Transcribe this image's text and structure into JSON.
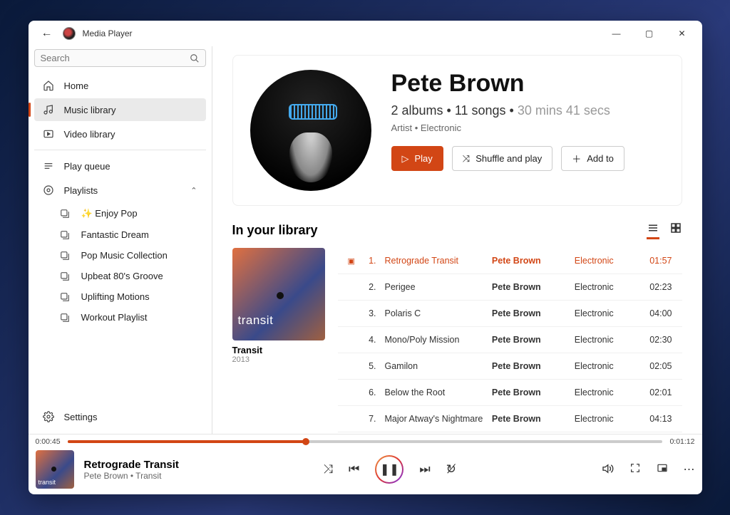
{
  "app_title": "Media Player",
  "search_placeholder": "Search",
  "sidebar": {
    "home": "Home",
    "music": "Music library",
    "video": "Video library",
    "queue": "Play queue",
    "playlists_label": "Playlists",
    "playlists": [
      {
        "label": "✨ Enjoy Pop"
      },
      {
        "label": "Fantastic Dream"
      },
      {
        "label": "Pop Music Collection"
      },
      {
        "label": "Upbeat 80's Groove"
      },
      {
        "label": "Uplifting Motions"
      },
      {
        "label": "Workout Playlist"
      }
    ],
    "settings": "Settings"
  },
  "artist": {
    "name": "Pete Brown",
    "meta_prefix": "2 albums • 11 songs • ",
    "meta_dim": "30 mins 41 secs",
    "role": "Artist • Electronic",
    "play_label": "Play",
    "shuffle_label": "Shuffle and play",
    "addto_label": "Add to"
  },
  "section_title": "In your library",
  "album": {
    "title": "Transit",
    "year": "2013",
    "art_label": "transit"
  },
  "tracks": [
    {
      "n": "1.",
      "name": "Retrograde Transit",
      "artist": "Pete Brown",
      "genre": "Electronic",
      "dur": "01:57",
      "playing": true
    },
    {
      "n": "2.",
      "name": "Perigee",
      "artist": "Pete Brown",
      "genre": "Electronic",
      "dur": "02:23"
    },
    {
      "n": "3.",
      "name": "Polaris C",
      "artist": "Pete Brown",
      "genre": "Electronic",
      "dur": "04:00"
    },
    {
      "n": "4.",
      "name": "Mono/Poly Mission",
      "artist": "Pete Brown",
      "genre": "Electronic",
      "dur": "02:30"
    },
    {
      "n": "5.",
      "name": "Gamilon",
      "artist": "Pete Brown",
      "genre": "Electronic",
      "dur": "02:05"
    },
    {
      "n": "6.",
      "name": "Below the Root",
      "artist": "Pete Brown",
      "genre": "Electronic",
      "dur": "02:01"
    },
    {
      "n": "7.",
      "name": "Major Atway's Nightmare",
      "artist": "Pete Brown",
      "genre": "Electronic",
      "dur": "04:13"
    }
  ],
  "player": {
    "elapsed": "0:00:45",
    "total": "0:01:12",
    "progress_pct": 40,
    "title": "Retrograde Transit",
    "subtitle": "Pete Brown • Transit",
    "art_label": "transit"
  }
}
